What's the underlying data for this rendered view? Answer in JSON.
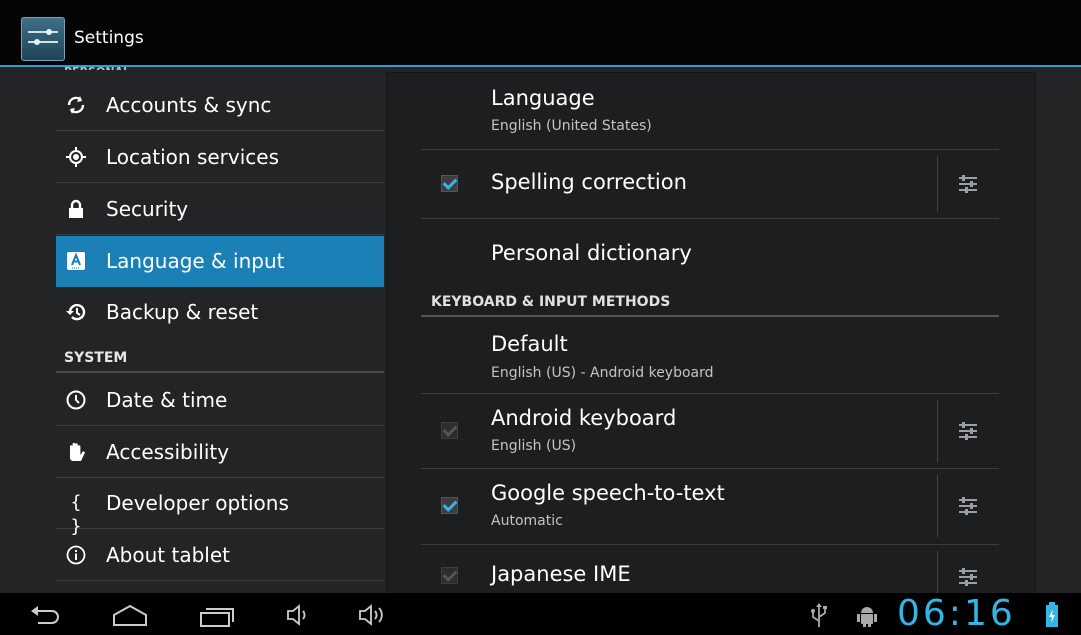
{
  "app": {
    "title": "Settings"
  },
  "sidebar": {
    "cut_header": "PERSONAL",
    "items_personal": [
      {
        "label": "Accounts & sync",
        "icon": "sync-icon"
      },
      {
        "label": "Location services",
        "icon": "location-icon"
      },
      {
        "label": "Security",
        "icon": "lock-icon"
      },
      {
        "label": "Language & input",
        "icon": "language-icon",
        "active": true
      },
      {
        "label": "Backup & reset",
        "icon": "backup-icon"
      }
    ],
    "system_header": "SYSTEM",
    "items_system": [
      {
        "label": "Date & time",
        "icon": "clock-icon"
      },
      {
        "label": "Accessibility",
        "icon": "hand-icon"
      },
      {
        "label": "Developer options",
        "icon": "braces-icon",
        "glyph": "{ }"
      },
      {
        "label": "About tablet",
        "icon": "info-icon"
      }
    ]
  },
  "content": {
    "language": {
      "title": "Language",
      "subtitle": "English (United States)"
    },
    "spelling": {
      "title": "Spelling correction",
      "checked": true
    },
    "dictionary": {
      "title": "Personal dictionary"
    },
    "keyboard_header": "KEYBOARD & INPUT METHODS",
    "default": {
      "title": "Default",
      "subtitle": "English (US) - Android keyboard"
    },
    "android_keyboard": {
      "title": "Android keyboard",
      "subtitle": "English (US)",
      "checked": true,
      "enabled": false
    },
    "google_speech": {
      "title": "Google speech-to-text",
      "subtitle": "Automatic",
      "checked": true
    },
    "japanese_ime": {
      "title": "Japanese IME",
      "checked": true,
      "enabled": false
    }
  },
  "statusbar": {
    "time": "06:16"
  },
  "colors": {
    "accent": "#33b5e5",
    "active_item": "#1b80b5",
    "actionbar_line": "#2a9fd0"
  }
}
